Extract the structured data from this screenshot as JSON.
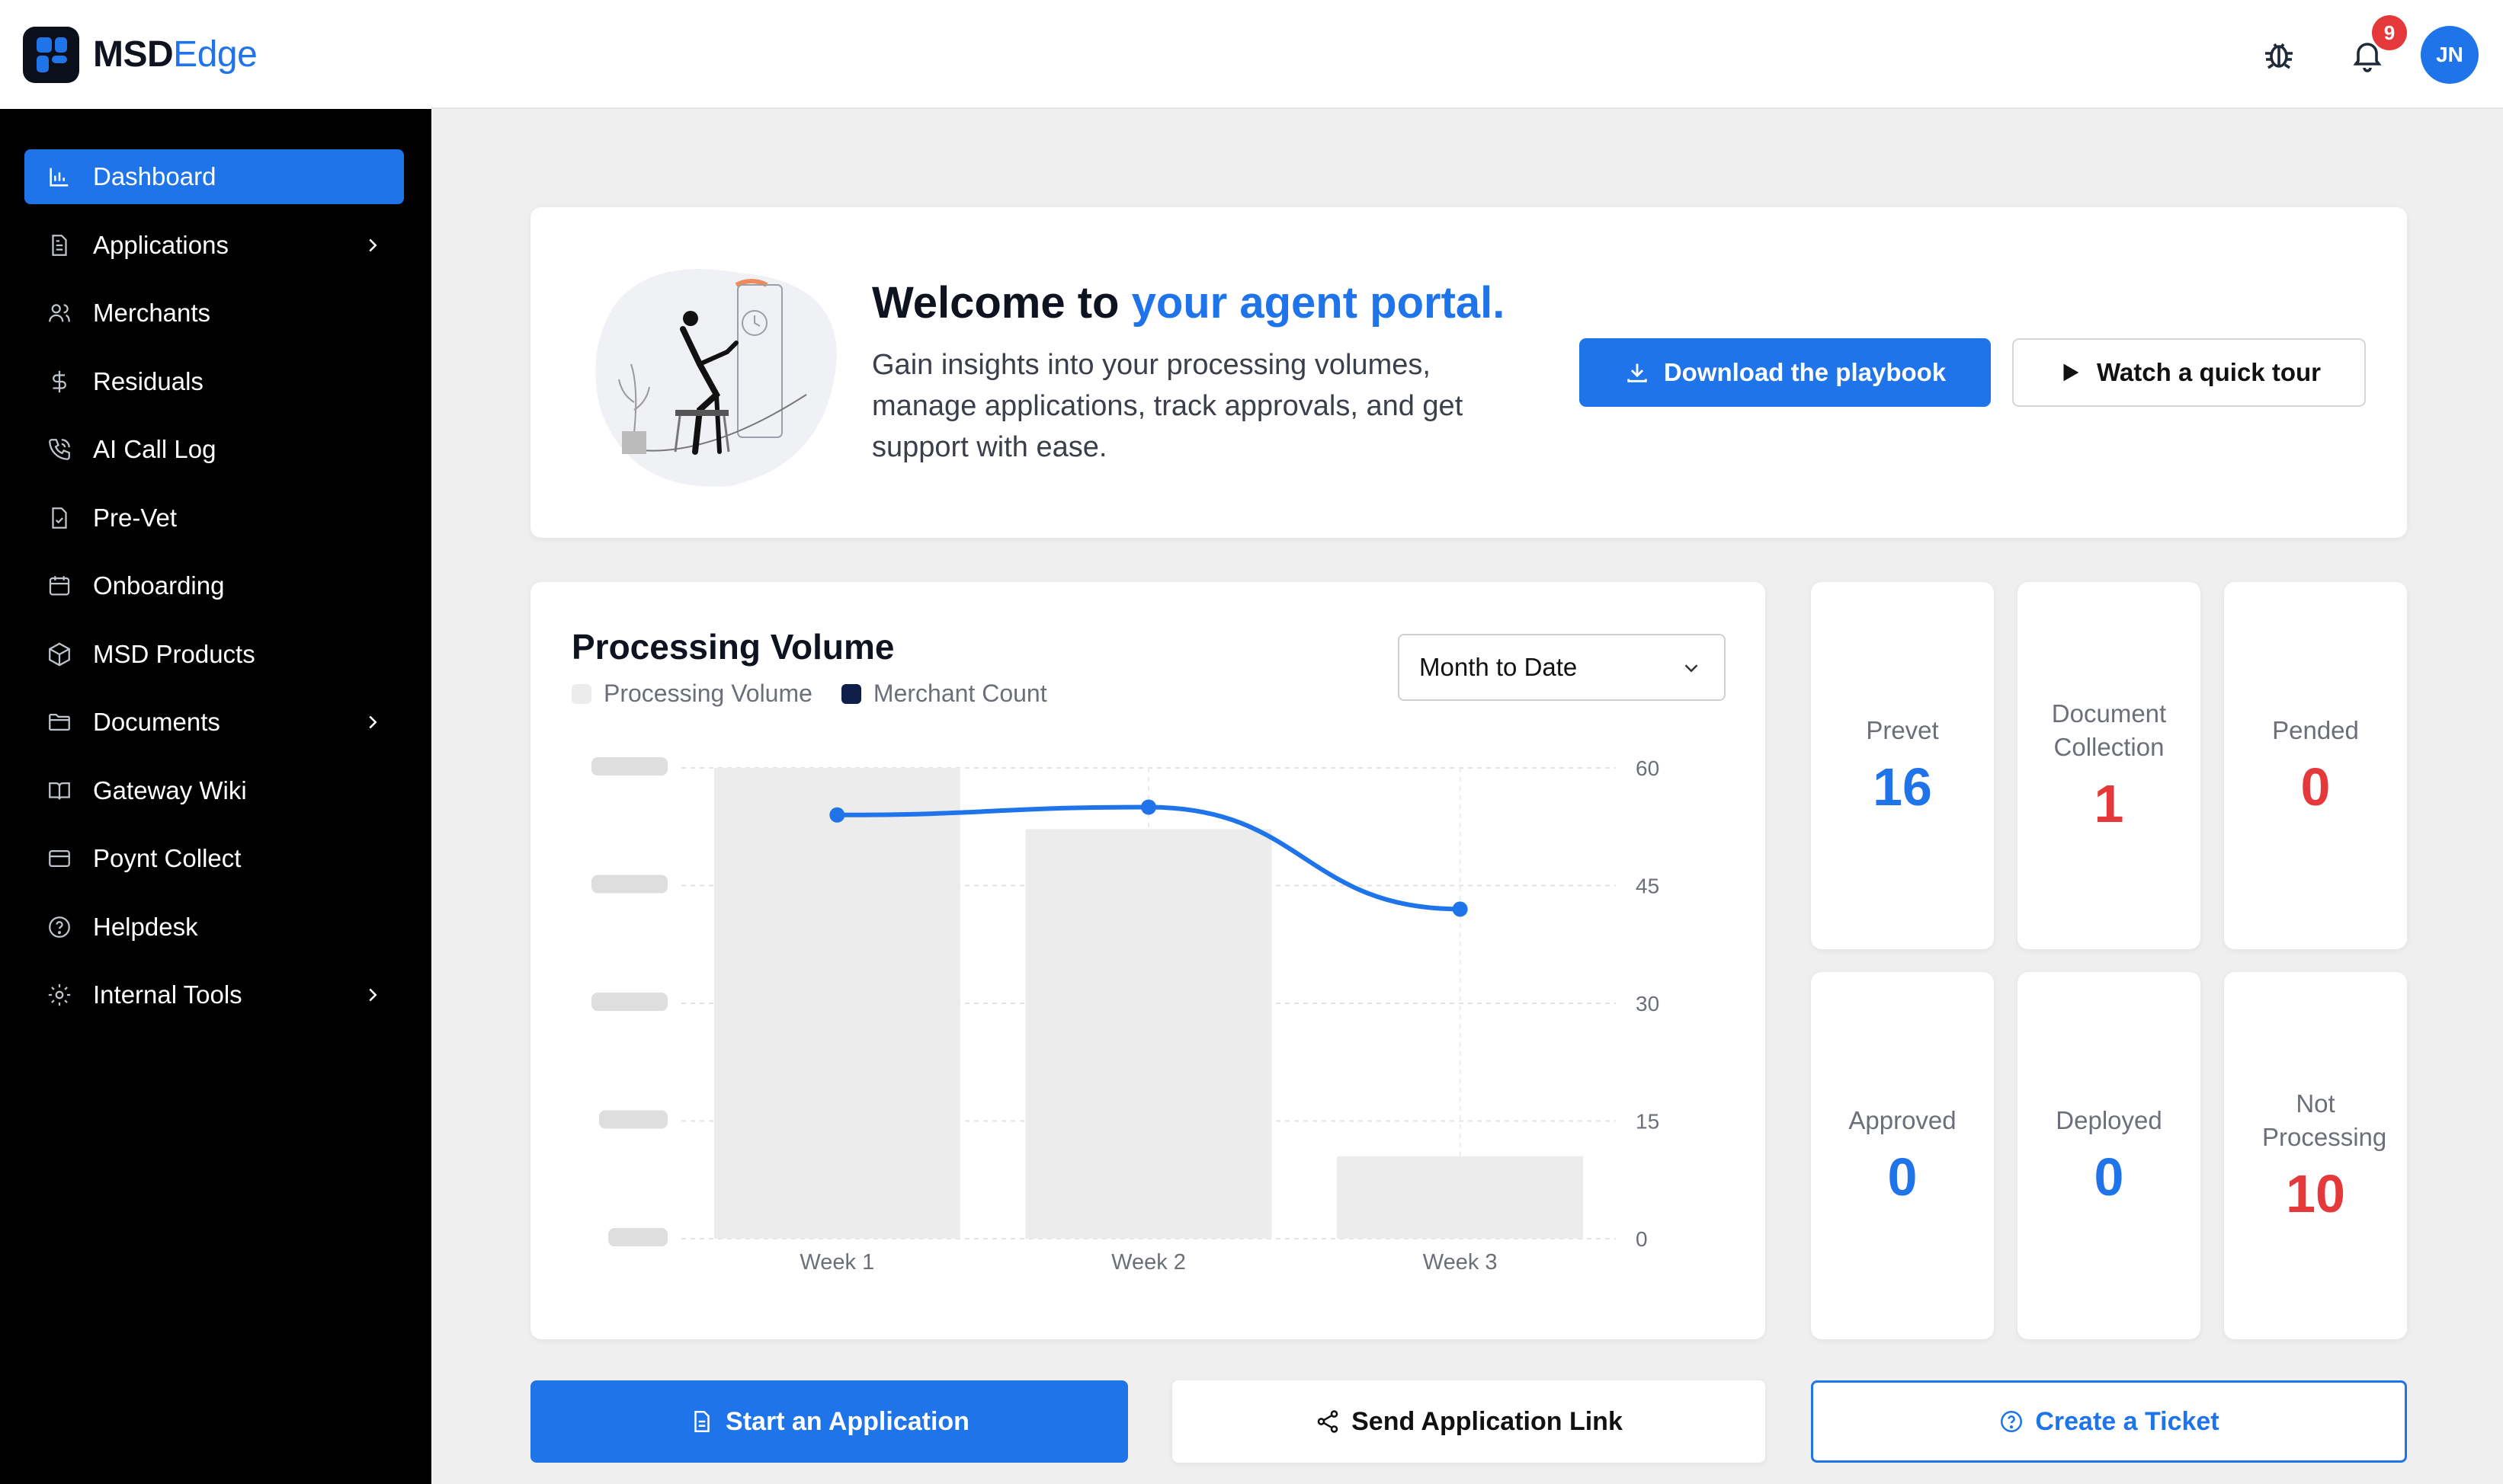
{
  "brand": {
    "name_primary": "MSD",
    "name_accent": "Edge"
  },
  "colors": {
    "accent": "#1f74ea",
    "danger": "#e5383b",
    "sidebar_bg": "#000000"
  },
  "sidebar": {
    "items": [
      {
        "label": "Dashboard",
        "icon": "bar-chart-icon",
        "active": true,
        "expandable": false
      },
      {
        "label": "Applications",
        "icon": "file-icon",
        "expandable": true
      },
      {
        "label": "Merchants",
        "icon": "users-icon",
        "expandable": false
      },
      {
        "label": "Residuals",
        "icon": "dollar-icon",
        "expandable": false
      },
      {
        "label": "AI Call Log",
        "icon": "phone-icon",
        "expandable": false
      },
      {
        "label": "Pre-Vet",
        "icon": "file-check-icon",
        "expandable": false
      },
      {
        "label": "Onboarding",
        "icon": "calendar-icon",
        "expandable": false
      },
      {
        "label": "MSD Products",
        "icon": "box-icon",
        "expandable": false
      },
      {
        "label": "Documents",
        "icon": "folder-icon",
        "expandable": true
      },
      {
        "label": "Gateway Wiki",
        "icon": "book-icon",
        "expandable": false
      },
      {
        "label": "Poynt Collect",
        "icon": "credit-card-icon",
        "expandable": false
      },
      {
        "label": "Helpdesk",
        "icon": "help-circle-icon",
        "expandable": false
      },
      {
        "label": "Internal Tools",
        "icon": "gear-icon",
        "expandable": true
      }
    ]
  },
  "topbar": {
    "notification_count": "9",
    "user_initials": "JN",
    "icons": [
      "bug-icon",
      "bell-icon"
    ]
  },
  "welcome": {
    "title_prefix": "Welcome to ",
    "title_accent": "your agent portal.",
    "description": "Gain insights into your processing volumes, manage applications, track approvals, and get support with ease.",
    "primary_button": "Download the playbook",
    "secondary_button": "Watch a quick tour"
  },
  "volume": {
    "title": "Processing Volume",
    "period_select": "Month to Date",
    "legend": [
      {
        "label": "Processing Volume",
        "color": "#ececec"
      },
      {
        "label": "Merchant Count",
        "color": "#0f1f4a"
      }
    ]
  },
  "chart_data": {
    "type": "bar",
    "categories": [
      "Week 1",
      "Week 2",
      "Week 3"
    ],
    "series": [
      {
        "name": "Processing Volume",
        "type": "bar",
        "axis": "left",
        "values": [
          1.0,
          0.87,
          0.175
        ],
        "note_values_blurred": true
      },
      {
        "name": "Merchant Count",
        "type": "line",
        "axis": "right",
        "values": [
          54,
          55,
          42
        ]
      }
    ],
    "y_right_ticks": [
      0,
      15,
      30,
      45,
      60
    ],
    "y_right_lim": [
      0,
      60
    ],
    "y_left_labels_blurred": true,
    "grid": true
  },
  "stats": [
    {
      "label": "Prevet",
      "value": "16",
      "color": "blue"
    },
    {
      "label": "Document Collection",
      "value": "1",
      "color": "red"
    },
    {
      "label": "Pended",
      "value": "0",
      "color": "red"
    },
    {
      "label": "Approved",
      "value": "0",
      "color": "blue"
    },
    {
      "label": "Deployed",
      "value": "0",
      "color": "blue"
    },
    {
      "label": "Not Processing",
      "value": "10",
      "color": "red"
    }
  ],
  "actions": {
    "start_application": "Start an Application",
    "send_link": "Send Application Link",
    "create_ticket": "Create a Ticket"
  }
}
